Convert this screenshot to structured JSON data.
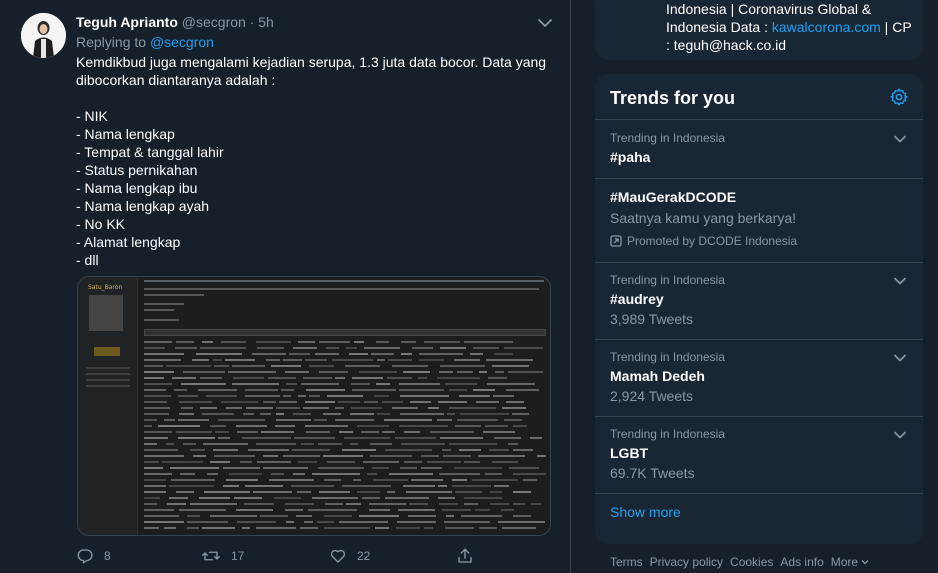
{
  "tweet": {
    "author_name": "Teguh Aprianto",
    "handle": "@secgron",
    "time": "5h",
    "replying_prefix": "Replying to",
    "replying_handle": "@secgron",
    "lines": [
      "Kemdikbud juga mengalami kejadian serupa, 1.3 juta data  bocor. Data yang",
      "dibocorkan diantaranya adalah :",
      "",
      "- NIK",
      "- Nama lengkap",
      "- Tempat & tanggal lahir",
      "- Status pernikahan",
      "- Nama lengkap ibu",
      "- Nama lengkap ayah",
      "- No KK",
      "- Alamat lengkap",
      "- dll"
    ],
    "attachment_user": "Satu_Baron",
    "actions": {
      "reply_icon": "reply-icon",
      "reply_count": "8",
      "retweet_icon": "retweet-icon",
      "retweet_count": "17",
      "like_icon": "heart-icon",
      "like_count": "22",
      "share_icon": "share-icon"
    }
  },
  "info": {
    "line1": "Indonesia | Coronavirus Global &",
    "line2_prefix": "Indonesia Data : ",
    "line2_link": "kawalcorona.com",
    "line2_suffix": " | CP",
    "line3": ": teguh@hack.co.id"
  },
  "trends": {
    "title": "Trends for you",
    "settings_icon": "gear-icon",
    "items": [
      {
        "context": "Trending in Indonesia",
        "title": "#paha",
        "sub": ""
      },
      {
        "context": "",
        "title": "#MauGerakDCODE",
        "sub": "Saatnya kamu yang berkarya!",
        "promoted": "Promoted by DCODE Indonesia"
      },
      {
        "context": "Trending in Indonesia",
        "title": "#audrey",
        "sub": "3,989 Tweets"
      },
      {
        "context": "Trending in Indonesia",
        "title": "Mamah Dedeh",
        "sub": "2,924 Tweets"
      },
      {
        "context": "Trending in Indonesia",
        "title": "LGBT",
        "sub": "69.7K Tweets"
      }
    ],
    "show_more": "Show more"
  },
  "footer": {
    "links": [
      "Terms",
      "Privacy policy",
      "Cookies",
      "Ads info",
      "More"
    ]
  },
  "colors": {
    "background": "#15202b",
    "card": "#192734",
    "accent": "#1da1f2",
    "muted": "#8899a6",
    "border": "#38444d"
  }
}
